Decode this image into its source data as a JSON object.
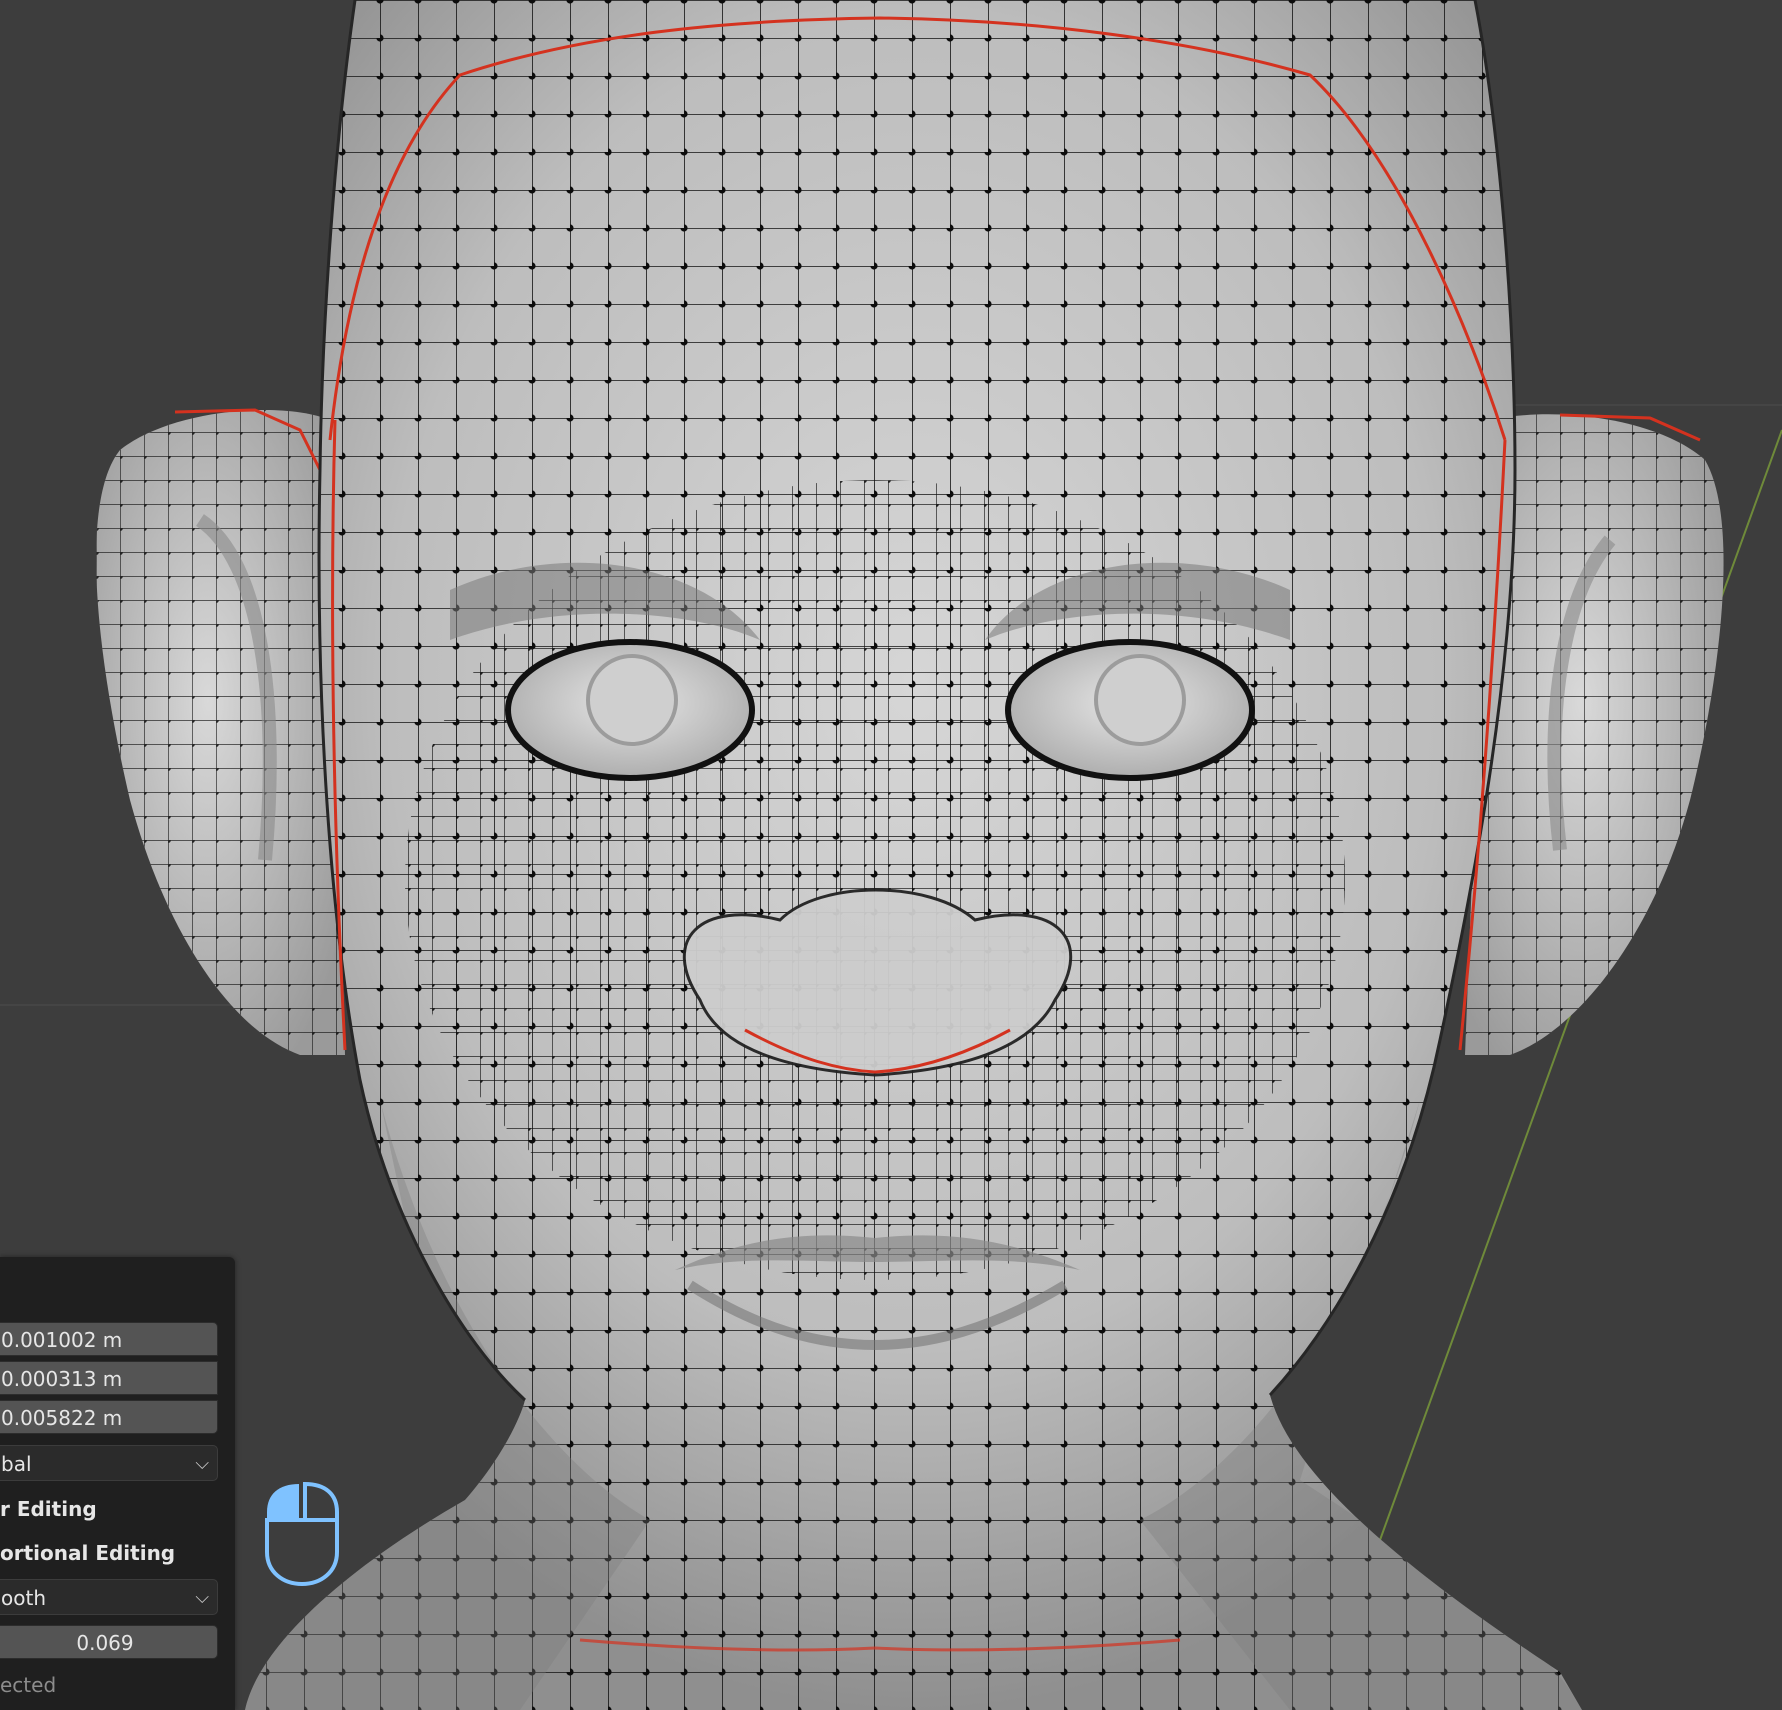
{
  "viewport": {
    "description_name": "blender-3d-viewport",
    "colors": {
      "background": "#3d3d3d",
      "mesh_surface": "#c9c9c9",
      "wire": "#101010",
      "seam": "#d4321f",
      "axis_line": "#6f8a3a"
    }
  },
  "operator_panel": {
    "offset_x": "0.001002 m",
    "offset_y": "0.000313 m",
    "offset_z": "0.005822 m",
    "orientation": "bal",
    "option_editing": "r Editing",
    "option_proportional": "ortional Editing",
    "falloff": "ooth",
    "proportional_size": "0.069",
    "connected": "ected"
  },
  "mouse_hint": {
    "icon": "mouse-left-click-icon",
    "accent": "#7fc2ff"
  }
}
